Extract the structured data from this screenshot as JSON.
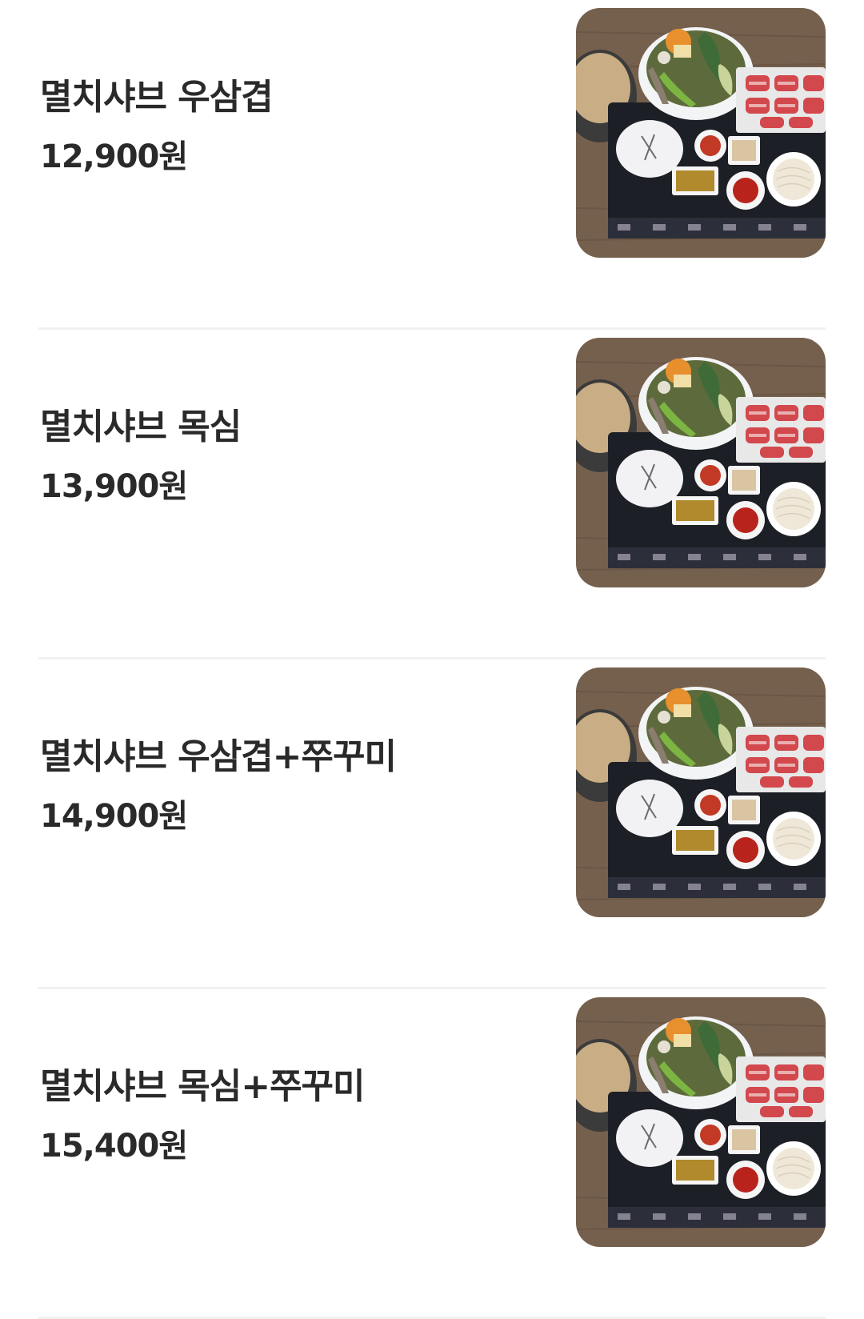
{
  "menu": {
    "items": [
      {
        "name": "멸치샤브 우삼겹",
        "price": "12,900원"
      },
      {
        "name": "멸치샤브 목심",
        "price": "13,900원"
      },
      {
        "name": "멸치샤브 우삼겹+쭈꾸미",
        "price": "14,900원"
      },
      {
        "name": "멸치샤브 목심+쭈꾸미",
        "price": "15,400원"
      }
    ]
  },
  "colors": {
    "text": "#2a2a2a",
    "divider": "#f1f1f1",
    "background": "#ffffff"
  }
}
